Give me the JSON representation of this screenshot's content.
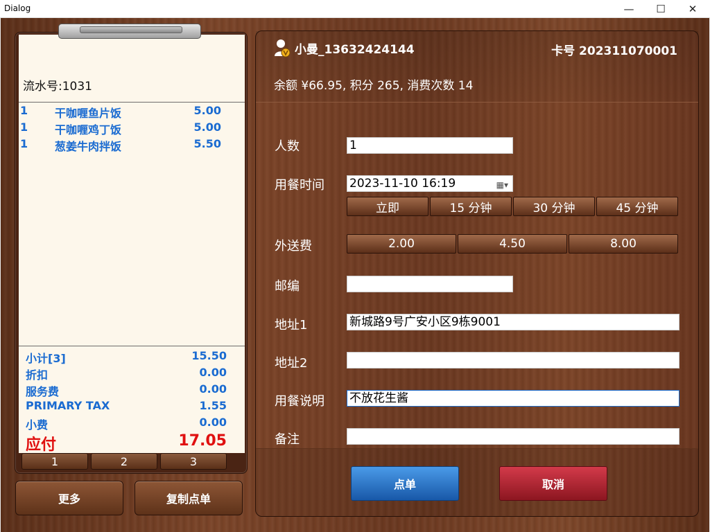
{
  "window": {
    "title": "Dialog",
    "min_glyph": "—",
    "max_glyph": "☐",
    "close_glyph": "✕"
  },
  "receipt": {
    "serial": "流水号:1031",
    "items": [
      {
        "qty": "1",
        "name": "干咖喱鱼片饭",
        "price": "5.00"
      },
      {
        "qty": "1",
        "name": "干咖喱鸡丁饭",
        "price": "5.00"
      },
      {
        "qty": "1",
        "name": "葱姜牛肉拌饭",
        "price": "5.50"
      }
    ],
    "totals": [
      {
        "label": "小计[3]",
        "value": "15.50"
      },
      {
        "label": "折扣",
        "value": "0.00"
      },
      {
        "label": "服务费",
        "value": "0.00"
      },
      {
        "label": "PRIMARY TAX",
        "value": "1.55"
      },
      {
        "label": "小费",
        "value": "0.00"
      }
    ],
    "due": {
      "label": "应付",
      "value": "17.05"
    },
    "pages": [
      "1",
      "2",
      "3"
    ]
  },
  "left_buttons": {
    "more": "更多",
    "copy_order": "复制点单"
  },
  "member": {
    "name": "小曼_13632424144",
    "card": "卡号 202311070001",
    "balance": "余额 ¥66.95, 积分 265, 消费次数 14"
  },
  "form": {
    "people_label": "人数",
    "people_value": "1",
    "time_label": "用餐时间",
    "time_value": "2023-11-10 16:19",
    "time_buttons": [
      "立即",
      "15 分钟",
      "30 分钟",
      "45 分钟"
    ],
    "delivery_label": "外送费",
    "delivery_buttons": [
      "2.00",
      "4.50",
      "8.00"
    ],
    "zip_label": "邮编",
    "zip_value": "",
    "addr1_label": "地址1",
    "addr1_value": "新城路9号广安小区9栋9001",
    "addr2_label": "地址2",
    "addr2_value": "",
    "note_label": "用餐说明",
    "note_value": "不放花生酱",
    "remark_label": "备注",
    "remark_value": ""
  },
  "actions": {
    "order": "点单",
    "cancel": "取消"
  },
  "colors": {
    "item_blue": "#1a6bd1",
    "due_red": "#e01010",
    "order_blue": "#1f6ec4",
    "cancel_red": "#a81e2a"
  }
}
